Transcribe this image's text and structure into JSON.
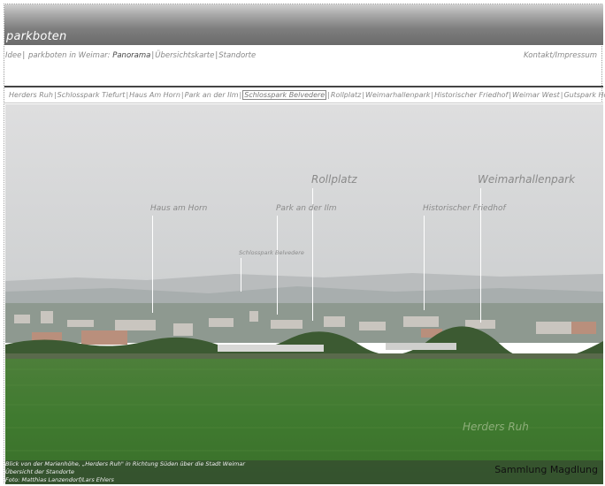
{
  "site": {
    "title": "parkboten"
  },
  "topnav": {
    "items": [
      {
        "label": "Idee",
        "active": false
      },
      {
        "label": "parkboten in Weimar:",
        "active": false
      },
      {
        "label": "Panorama",
        "active": true
      },
      {
        "label": "Übersichtskarte",
        "active": false
      },
      {
        "label": "Standorte",
        "active": false
      }
    ],
    "right": {
      "contact": "Kontakt",
      "imprint": "Impressum"
    }
  },
  "locations": {
    "items": [
      {
        "label": "Herders Ruh",
        "active": false
      },
      {
        "label": "Schlosspark Tiefurt",
        "active": false
      },
      {
        "label": "Haus Am Horn",
        "active": false
      },
      {
        "label": "Park an der Ilm",
        "active": false
      },
      {
        "label": "Schlosspark Belvedere",
        "active": true
      },
      {
        "label": "Rollplatz",
        "active": false
      },
      {
        "label": "Weimarhallenpark",
        "active": false
      },
      {
        "label": "Historischer Friedhof",
        "active": false
      },
      {
        "label": "Weimar West",
        "active": false
      },
      {
        "label": "Gutspark Holzdorf",
        "active": false
      }
    ]
  },
  "panorama": {
    "labels": {
      "haus_am_horn": "Haus am Horn",
      "park_an_der_ilm": "Park an der Ilm",
      "rollplatz": "Rollplatz",
      "historischer_friedhof": "Historischer Friedhof",
      "weimarhallenpark": "Weimarhallenpark",
      "schlosspark_belvedere": "Schlosspark Belvedere",
      "herders_ruh": "Herders Ruh"
    },
    "caption": {
      "line1": "Blick von der Marienhöhe, „Herders Ruh\" in Richtung Süden über die Stadt Weimar",
      "line2": "Übersicht der Standorte",
      "line3": "Foto: Matthias Lanzendorf/Lars Ehlers"
    },
    "watermark": "Sammlung Magdlung"
  },
  "colors": {
    "header_dark": "#6a6a6a",
    "sky": "#d9d9da",
    "field": "#3f7a2f"
  }
}
